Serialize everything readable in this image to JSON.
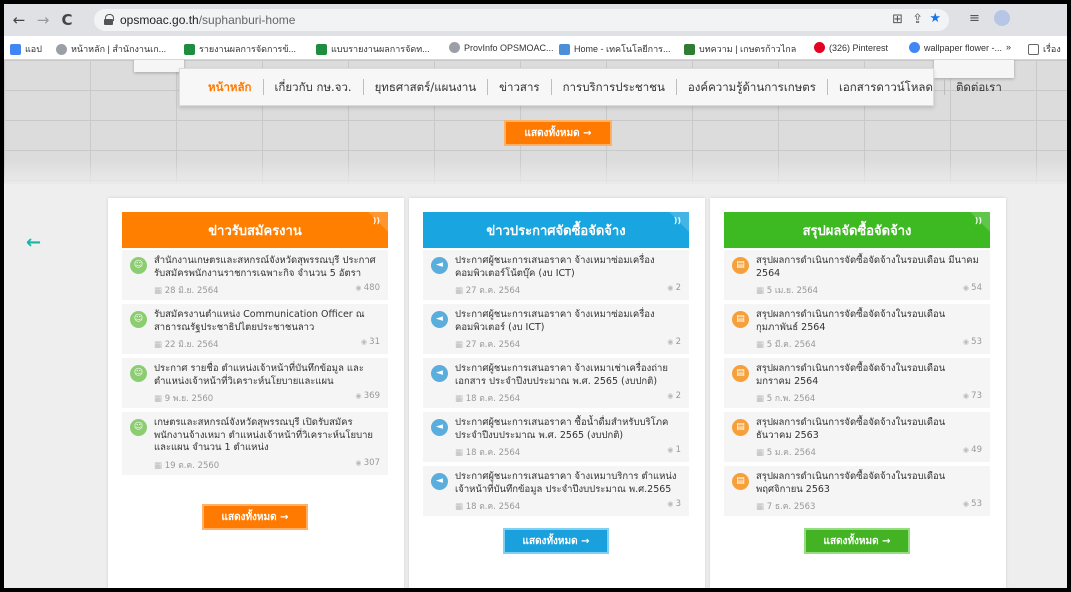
{
  "browser": {
    "back": "←",
    "forward": "→",
    "reload": "C",
    "url_host": "opsmoac.go.th",
    "url_path": "/suphanburi-home",
    "bookmarks": [
      {
        "label": "แอป",
        "color": "#4285f4"
      },
      {
        "label": "หน้าหลัก | สำนักงานเก...",
        "color": "#9aa0a6"
      },
      {
        "label": "รายงานผลการจัดการข้...",
        "color": "#1e8e3e"
      },
      {
        "label": "แบบรายงานผลการจัดท...",
        "color": "#1e8e3e"
      },
      {
        "label": "ProvInfo OPSMOAC...",
        "color": "#9aa0a6"
      },
      {
        "label": "Home - เทคโนโลยีการ...",
        "color": "#4a90d9"
      },
      {
        "label": "บทความ | เกษตรก้าวไกล",
        "color": "#2e7d32"
      },
      {
        "label": "(326) Pinterest",
        "color": "#e60023"
      },
      {
        "label": "wallpaper flower -...",
        "color": "#4285f4"
      }
    ],
    "bookmarks_more": "»",
    "reading_list": "เรื่อง"
  },
  "menu": [
    "หน้าหลัก",
    "เกี่ยวกับ กษ.จว.",
    "ยุทธศาสตร์/แผนงาน",
    "ข่าวสาร",
    "การบริการประชาชน",
    "องค์ความรู้ด้านการเกษตร",
    "เอกสารดาวน์โหลด",
    "ติดต่อเรา"
  ],
  "show_all_label": "แสดงทั้งหมด →",
  "side_arrow": "←",
  "columns": [
    {
      "title": "ข่าวรับสมัครงาน",
      "accent": "#ff7f00",
      "icon": "user-icon",
      "items": [
        {
          "title": "สำนักงานเกษตรและสหกรณ์จังหวัดสุพรรณบุรี ประกาศรับสมัครพนักงานราชการเฉพาะกิจ จำนวน 5 อัตรา",
          "date": "28 มิ.ย. 2564",
          "views": "480"
        },
        {
          "title": "รับสมัครงานตำแหน่ง Communication Officer ณ สาธารณรัฐประชาธิปไตยประชาชนลาว",
          "date": "22 มิ.ย. 2564",
          "views": "31"
        },
        {
          "title": "ประกาศ รายชื่อ ตำแหน่งเจ้าหน้าที่บันทึกข้อมูล และตำแหน่งเจ้าหน้าที่วิเคราะห์นโยบายและแผน",
          "date": "9 พ.ย. 2560",
          "views": "369"
        },
        {
          "title": "เกษตรและสหกรณ์จังหวัดสุพรรณบุรี เปิดรับสมัครพนักงานจ้างเหมา ตำแหน่งเจ้าหน้าที่วิเคราะห์นโยบายและแผน จำนวน 1 ตำแหน่ง",
          "date": "19 ต.ค. 2560",
          "views": "307"
        }
      ]
    },
    {
      "title": "ข่าวประกาศจัดซื้อจัดจ้าง",
      "accent": "#19a5e0",
      "icon": "megaphone-icon",
      "items": [
        {
          "title": "ประกาศผู้ชนะการเสนอราคา จ้างเหมาซ่อมเครื่องคอมพิวเตอร์โน้ตบุ๊ค (งบ ICT)",
          "date": "27 ต.ค. 2564",
          "views": "2"
        },
        {
          "title": "ประกาศผู้ชนะการเสนอราคา จ้างเหมาซ่อมเครื่องคอมพิวเตอร์ (งบ ICT)",
          "date": "27 ต.ค. 2564",
          "views": "2"
        },
        {
          "title": "ประกาศผู้ชนะการเสนอราคา จ้างเหมาเช่าเครื่องถ่ายเอกสาร ประจำปีงบประมาณ พ.ศ. 2565 (งบปกติ)",
          "date": "18 ต.ค. 2564",
          "views": "2"
        },
        {
          "title": "ประกาศผู้ชนะการเสนอราคา ซื้อน้ำดื่มสำหรับบริโภค ประจำปีงบประมาณ พ.ศ. 2565 (งบปกติ)",
          "date": "18 ต.ค. 2564",
          "views": "1"
        },
        {
          "title": "ประกาศผู้ชนะการเสนอราคา จ้างเหมาบริการ ตำแหน่งเจ้าหน้าที่บันทึกข้อมูล ประจำปีงบประมาณ พ.ศ.2565",
          "date": "18 ต.ค. 2564",
          "views": "3"
        }
      ]
    },
    {
      "title": "สรุปผลจัดซื้อจัดจ้าง",
      "accent": "#3dba21",
      "icon": "document-icon",
      "items": [
        {
          "title": "สรุปผลการดำเนินการจัดซื้อจัดจ้างในรอบเดือน มีนาคม 2564",
          "date": "5 เม.ย. 2564",
          "views": "54"
        },
        {
          "title": "สรุปผลการดำเนินการจัดซื้อจัดจ้างในรอบเดือน กุมภาพันธ์ 2564",
          "date": "5 มี.ค. 2564",
          "views": "53"
        },
        {
          "title": "สรุปผลการดำเนินการจัดซื้อจัดจ้างในรอบเดือน มกราคม 2564",
          "date": "5 ก.พ. 2564",
          "views": "73"
        },
        {
          "title": "สรุปผลการดำเนินการจัดซื้อจัดจ้างในรอบเดือน ธันวาคม 2563",
          "date": "5 ม.ค. 2564",
          "views": "49"
        },
        {
          "title": "สรุปผลการดำเนินการจัดซื้อจัดจ้างในรอบเดือน พฤศจิกายน 2563",
          "date": "7 ธ.ค. 2563",
          "views": "53"
        }
      ]
    }
  ]
}
